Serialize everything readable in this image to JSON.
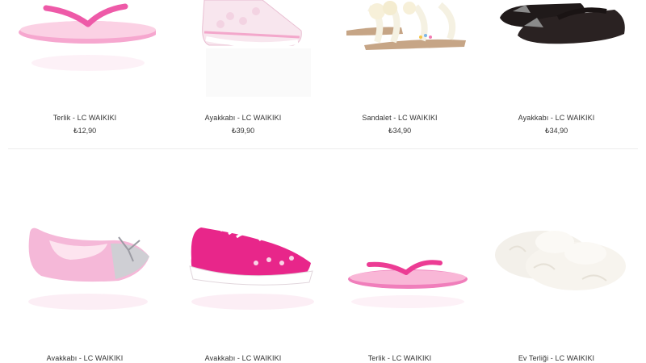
{
  "products": [
    {
      "name": "Terlik - LC WAIKIKI",
      "price": "₺12,90",
      "icon": "pink-flip-flop-icon"
    },
    {
      "name": "Ayakkabı - LC WAIKIKI",
      "price": "₺39,90",
      "icon": "lace-sneaker-icon"
    },
    {
      "name": "Sandalet - LC WAIKIKI",
      "price": "₺34,90",
      "icon": "sandal-icon"
    },
    {
      "name": "Ayakkabı - LC WAIKIKI",
      "price": "₺34,90",
      "icon": "black-flat-icon"
    },
    {
      "name": "Avakkabı - LC WAIKIKI",
      "price": "",
      "icon": "ballet-flat-icon"
    },
    {
      "name": "Avakkabı - LC WAIKIKI",
      "price": "",
      "icon": "pink-canvas-shoe-icon"
    },
    {
      "name": "Terlik - LC WAIKIKI",
      "price": "",
      "icon": "pink-flip-flop-icon"
    },
    {
      "name": "Ev Terliği - LC WAIKIKI",
      "price": "",
      "icon": "fur-slipper-icon"
    }
  ]
}
